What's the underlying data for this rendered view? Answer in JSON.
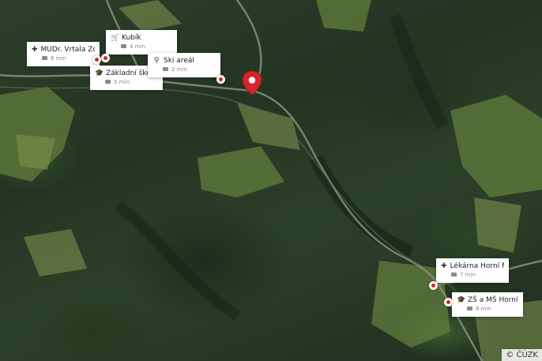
{
  "map": {
    "copyright": "© ČÚZK",
    "pois": [
      {
        "name": "MUDr. Vrtala Zde...",
        "time": "6 min",
        "icon": "medical-cross-icon"
      },
      {
        "name": "Kubík",
        "time": "4 min",
        "icon": "shopping-cart-icon"
      },
      {
        "name": "Základní škola a...",
        "time": "5 min",
        "icon": "school-cap-icon"
      },
      {
        "name": "Ski areál",
        "time": "2 min",
        "icon": "location-pin-icon"
      },
      {
        "name": "Lékárna Horní Ma...",
        "time": "7 min",
        "icon": "medical-cross-icon"
      },
      {
        "name": "ZŠ a MŠ Horní Ma...",
        "time": "8 min",
        "icon": "school-cap-icon"
      }
    ],
    "colors": {
      "pin": "#d6242b",
      "satellite_base": "#2c3f2a"
    }
  }
}
